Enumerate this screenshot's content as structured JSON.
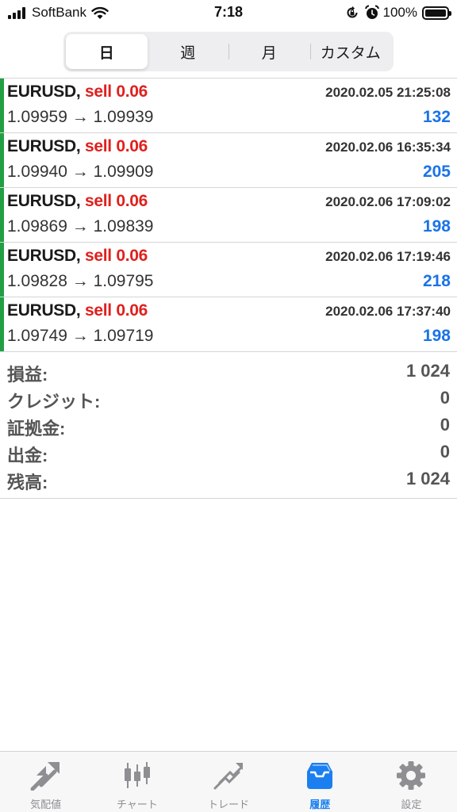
{
  "status_bar": {
    "carrier": "SoftBank",
    "time": "7:18",
    "battery": "100%"
  },
  "period_tabs": [
    {
      "label": "日",
      "active": true
    },
    {
      "label": "週",
      "active": false
    },
    {
      "label": "月",
      "active": false
    },
    {
      "label": "カスタム",
      "active": false
    }
  ],
  "trades": [
    {
      "symbol": "EURUSD,",
      "side": "sell 0.06",
      "time": "2020.02.05 21:25:08",
      "prices": "1.09959 → 1.09939",
      "profit": "132"
    },
    {
      "symbol": "EURUSD,",
      "side": "sell 0.06",
      "time": "2020.02.06 16:35:34",
      "prices": "1.09940 → 1.09909",
      "profit": "205"
    },
    {
      "symbol": "EURUSD,",
      "side": "sell 0.06",
      "time": "2020.02.06 17:09:02",
      "prices": "1.09869 → 1.09839",
      "profit": "198"
    },
    {
      "symbol": "EURUSD,",
      "side": "sell 0.06",
      "time": "2020.02.06 17:19:46",
      "prices": "1.09828 → 1.09795",
      "profit": "218"
    },
    {
      "symbol": "EURUSD,",
      "side": "sell 0.06",
      "time": "2020.02.06 17:37:40",
      "prices": "1.09749 → 1.09719",
      "profit": "198"
    }
  ],
  "summary": [
    {
      "label": "損益:",
      "value": "1 024"
    },
    {
      "label": "クレジット:",
      "value": "0"
    },
    {
      "label": "証拠金:",
      "value": "0"
    },
    {
      "label": "出金:",
      "value": "0"
    },
    {
      "label": "残高:",
      "value": "1 024"
    }
  ],
  "tabbar": [
    {
      "label": "気配値",
      "icon": "quotes-icon",
      "active": false
    },
    {
      "label": "チャート",
      "icon": "chart-icon",
      "active": false
    },
    {
      "label": "トレード",
      "icon": "trade-icon",
      "active": false
    },
    {
      "label": "履歴",
      "icon": "history-icon",
      "active": true
    },
    {
      "label": "設定",
      "icon": "settings-icon",
      "active": false
    }
  ],
  "colors": {
    "buy_sell_bar": "#21a043",
    "sell_text": "#e0201d",
    "profit_text": "#1a73e8",
    "tab_active": "#1b7ff0",
    "tab_inactive": "#8e8e93"
  }
}
